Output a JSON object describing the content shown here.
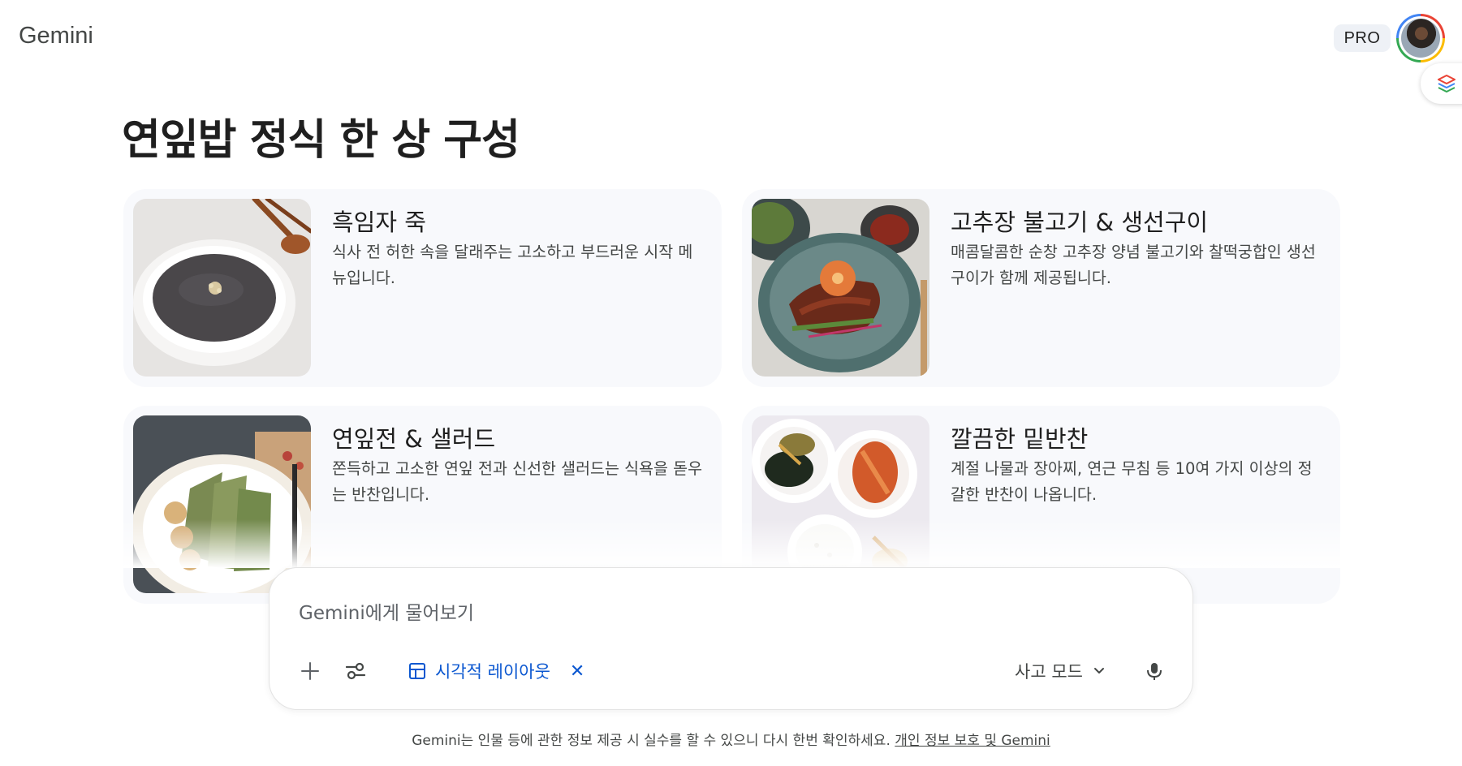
{
  "header": {
    "brand": "Gemini",
    "plan_badge": "PRO",
    "avatar_icon": "user-avatar",
    "side_tab_icon": "canvas-layers-icon"
  },
  "main": {
    "title": "연잎밥 정식 한 상 구성",
    "cards": [
      {
        "title": "흑임자 죽",
        "description": "식사 전 허한 속을 달래주는 고소하고 부드러운 시작 메뉴입니다.",
        "image": "black-sesame-porridge-photo"
      },
      {
        "title": "고추장 불고기 & 생선구이",
        "description": "매콤달콤한 순창 고추장 양념 불고기와 찰떡궁합인 생선구이가 함께 제공됩니다.",
        "image": "gochujang-bulgogi-photo"
      },
      {
        "title": "연잎전 & 샐러드",
        "description": "쫀득하고 고소한 연잎 전과 신선한 샐러드는 식욕을 돋우는 반찬입니다.",
        "image": "lotus-leaf-pancake-photo"
      },
      {
        "title": "깔끔한 밑반찬",
        "description": "계절 나물과 장아찌, 연근 무침 등 10여 가지 이상의 정갈한 반찬이 나옵니다.",
        "image": "side-dishes-photo"
      }
    ]
  },
  "prompt": {
    "placeholder": "Gemini에게 물어보기",
    "add_icon": "plus-icon",
    "tools_icon": "tools-sliders-icon",
    "chip_label": "시각적 레이아웃",
    "chip_icon": "layout-grid-icon",
    "chip_close_icon": "close-icon",
    "mode_label": "사고 모드",
    "mode_icon": "chevron-down-icon",
    "mic_icon": "microphone-icon"
  },
  "footer": {
    "disclaimer": "Gemini는 인물 등에 관한 정보 제공 시 실수를 할 수 있으니 다시 한번 확인하세요.",
    "privacy_link": "개인 정보 보호 및 Gemini"
  },
  "colors": {
    "accent": "#0b57d0",
    "card_bg": "#f8f9fc",
    "text_primary": "#1f1f1f",
    "text_secondary": "#444746"
  }
}
